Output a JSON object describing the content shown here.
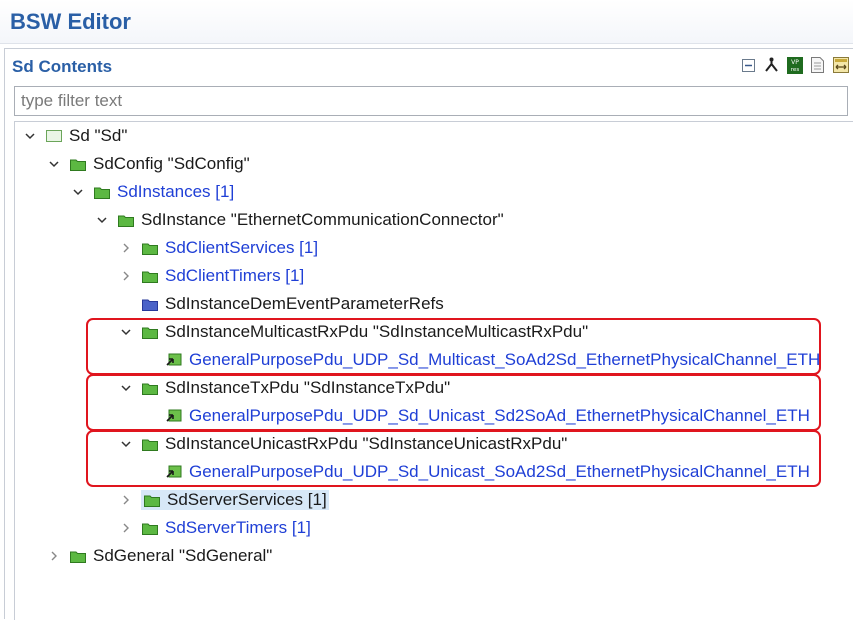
{
  "app": {
    "title": "BSW Editor"
  },
  "section": {
    "title": "Sd Contents",
    "toolbar": [
      {
        "name": "collapse-all-icon"
      },
      {
        "name": "hierarchy-icon"
      },
      {
        "name": "vp-res-icon",
        "text": "VP res"
      },
      {
        "name": "document-icon"
      },
      {
        "name": "layout-icon"
      }
    ]
  },
  "filter": {
    "placeholder": "type filter text",
    "value": ""
  },
  "tree": {
    "r0": {
      "label": "Sd \"Sd\""
    },
    "r1": {
      "label": "SdConfig \"SdConfig\""
    },
    "r2": {
      "label": "SdInstances [1]"
    },
    "r3": {
      "label": "SdInstance \"EthernetCommunicationConnector\""
    },
    "r4": {
      "label": "SdClientServices [1]"
    },
    "r5": {
      "label": "SdClientTimers [1]"
    },
    "r6": {
      "label": "SdInstanceDemEventParameterRefs"
    },
    "r7": {
      "label": "SdInstanceMulticastRxPdu \"SdInstanceMulticastRxPdu\""
    },
    "r8": {
      "label": "GeneralPurposePdu_UDP_Sd_Multicast_SoAd2Sd_EthernetPhysicalChannel_ETH"
    },
    "r9": {
      "label": "SdInstanceTxPdu \"SdInstanceTxPdu\""
    },
    "r10": {
      "label": "GeneralPurposePdu_UDP_Sd_Unicast_Sd2SoAd_EthernetPhysicalChannel_ETH"
    },
    "r11": {
      "label": "SdInstanceUnicastRxPdu \"SdInstanceUnicastRxPdu\""
    },
    "r12": {
      "label": "GeneralPurposePdu_UDP_Sd_Unicast_SoAd2Sd_EthernetPhysicalChannel_ETH"
    },
    "r13": {
      "label": "SdServerServices [1]"
    },
    "r14": {
      "label": "SdServerTimers [1]"
    },
    "r15": {
      "label": "SdGeneral \"SdGeneral\""
    }
  },
  "colors": {
    "title": "#2a5fa6",
    "link": "#1f3fd6",
    "highlight_border": "#e0151e",
    "selection": "#d7e8f7",
    "folder_green": "#3d9a2a",
    "folder_blue": "#3350b8"
  }
}
